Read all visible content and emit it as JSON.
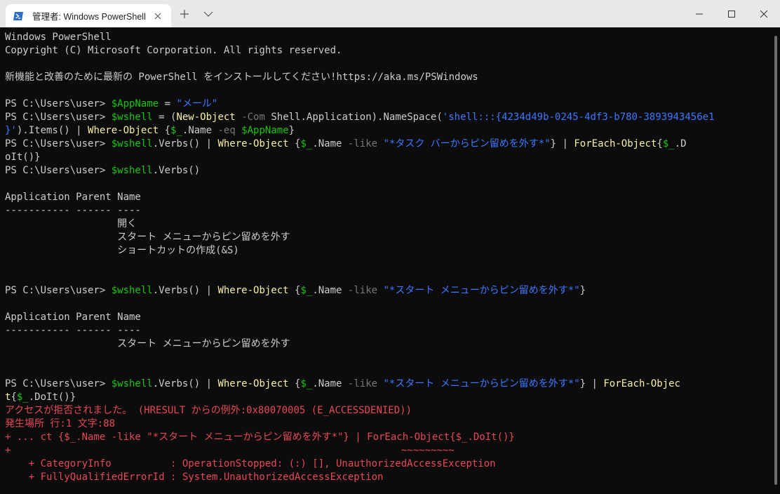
{
  "window": {
    "tab_title": "管理者: Windows PowerShell",
    "icons": {
      "tab": "powershell-icon",
      "close": "close-icon",
      "new_tab": "plus-icon",
      "dropdown": "chevron-down-icon",
      "minimize": "minimize-icon",
      "maximize": "maximize-icon",
      "window_close": "close-icon"
    }
  },
  "colors": {
    "background": "#0c0c0c",
    "text": "#cccccc",
    "variable": "#16c60c",
    "string": "#3b78ff",
    "command": "#f9f1a5",
    "parameter": "#767676",
    "error": "#e74856",
    "titlebar": "#e8e8e8"
  },
  "terminal": {
    "lines": [
      [
        {
          "t": "Windows PowerShell",
          "c": "default"
        }
      ],
      [
        {
          "t": "Copyright (C) Microsoft Corporation. All rights reserved.",
          "c": "default"
        }
      ],
      [],
      [
        {
          "t": "新機能と改善のために最新の PowerShell をインストールしてください!https://aka.ms/PSWindows",
          "c": "default"
        }
      ],
      [],
      [
        {
          "t": "PS C:\\Users\\user> ",
          "c": "default"
        },
        {
          "t": "$AppName",
          "c": "var"
        },
        {
          "t": " = ",
          "c": "default"
        },
        {
          "t": "\"メール\"",
          "c": "str"
        }
      ],
      [
        {
          "t": "PS C:\\Users\\user> ",
          "c": "default"
        },
        {
          "t": "$wshell",
          "c": "var"
        },
        {
          "t": " = (",
          "c": "default"
        },
        {
          "t": "New-Object",
          "c": "cmd"
        },
        {
          "t": " ",
          "c": "default"
        },
        {
          "t": "-Com",
          "c": "param"
        },
        {
          "t": " Shell.Application).NameSpace(",
          "c": "default"
        },
        {
          "t": "'shell:::{4234d49b-0245-4df3-b780-3893943456e1",
          "c": "str"
        }
      ],
      [
        {
          "t": "}'",
          "c": "str"
        },
        {
          "t": ").Items() | ",
          "c": "default"
        },
        {
          "t": "Where-Object",
          "c": "cmd"
        },
        {
          "t": " {",
          "c": "default"
        },
        {
          "t": "$_",
          "c": "var"
        },
        {
          "t": ".Name ",
          "c": "default"
        },
        {
          "t": "-eq",
          "c": "param"
        },
        {
          "t": " ",
          "c": "default"
        },
        {
          "t": "$AppName",
          "c": "var"
        },
        {
          "t": "}",
          "c": "default"
        }
      ],
      [
        {
          "t": "PS C:\\Users\\user> ",
          "c": "default"
        },
        {
          "t": "$wshell",
          "c": "var"
        },
        {
          "t": ".Verbs() | ",
          "c": "default"
        },
        {
          "t": "Where-Object",
          "c": "cmd"
        },
        {
          "t": " {",
          "c": "default"
        },
        {
          "t": "$_",
          "c": "var"
        },
        {
          "t": ".Name ",
          "c": "default"
        },
        {
          "t": "-like",
          "c": "param"
        },
        {
          "t": " ",
          "c": "default"
        },
        {
          "t": "\"*タスク バーからピン留めを外す*\"",
          "c": "str"
        },
        {
          "t": "} | ",
          "c": "default"
        },
        {
          "t": "ForEach-Object",
          "c": "cmd"
        },
        {
          "t": "{",
          "c": "default"
        },
        {
          "t": "$_",
          "c": "var"
        },
        {
          "t": ".D",
          "c": "default"
        }
      ],
      [
        {
          "t": "oIt()}",
          "c": "default"
        }
      ],
      [
        {
          "t": "PS C:\\Users\\user> ",
          "c": "default"
        },
        {
          "t": "$wshell",
          "c": "var"
        },
        {
          "t": ".Verbs()",
          "c": "default"
        }
      ],
      [],
      [
        {
          "t": "Application Parent Name",
          "c": "default"
        }
      ],
      [
        {
          "t": "----------- ------ ----",
          "c": "default"
        }
      ],
      [
        {
          "t": "                   開く",
          "c": "default"
        }
      ],
      [
        {
          "t": "                   スタート メニューからピン留めを外す",
          "c": "default"
        }
      ],
      [
        {
          "t": "                   ショートカットの作成(&S)",
          "c": "default"
        }
      ],
      [],
      [],
      [
        {
          "t": "PS C:\\Users\\user> ",
          "c": "default"
        },
        {
          "t": "$wshell",
          "c": "var"
        },
        {
          "t": ".Verbs() | ",
          "c": "default"
        },
        {
          "t": "Where-Object",
          "c": "cmd"
        },
        {
          "t": " {",
          "c": "default"
        },
        {
          "t": "$_",
          "c": "var"
        },
        {
          "t": ".Name ",
          "c": "default"
        },
        {
          "t": "-like",
          "c": "param"
        },
        {
          "t": " ",
          "c": "default"
        },
        {
          "t": "\"*スタート メニューからピン留めを外す*\"",
          "c": "str"
        },
        {
          "t": "}",
          "c": "default"
        }
      ],
      [],
      [
        {
          "t": "Application Parent Name",
          "c": "default"
        }
      ],
      [
        {
          "t": "----------- ------ ----",
          "c": "default"
        }
      ],
      [
        {
          "t": "                   スタート メニューからピン留めを外す",
          "c": "default"
        }
      ],
      [],
      [],
      [
        {
          "t": "PS C:\\Users\\user> ",
          "c": "default"
        },
        {
          "t": "$wshell",
          "c": "var"
        },
        {
          "t": ".Verbs() | ",
          "c": "default"
        },
        {
          "t": "Where-Object",
          "c": "cmd"
        },
        {
          "t": " {",
          "c": "default"
        },
        {
          "t": "$_",
          "c": "var"
        },
        {
          "t": ".Name ",
          "c": "default"
        },
        {
          "t": "-like",
          "c": "param"
        },
        {
          "t": " ",
          "c": "default"
        },
        {
          "t": "\"*スタート メニューからピン留めを外す*\"",
          "c": "str"
        },
        {
          "t": "} | ",
          "c": "default"
        },
        {
          "t": "ForEach-Objec",
          "c": "cmd"
        }
      ],
      [
        {
          "t": "t",
          "c": "cmd"
        },
        {
          "t": "{",
          "c": "default"
        },
        {
          "t": "$_",
          "c": "var"
        },
        {
          "t": ".DoIt()}",
          "c": "default"
        }
      ],
      [
        {
          "t": "アクセスが拒否されました。 (HRESULT からの例外:0x80070005 (E_ACCESSDENIED))",
          "c": "err"
        }
      ],
      [
        {
          "t": "発生場所 行:1 文字:88",
          "c": "err"
        }
      ],
      [
        {
          "t": "+ ... ct {$_.Name -like \"*スタート メニューからピン留めを外す*\"} | ForEach-Object{$_.DoIt()}",
          "c": "err"
        }
      ],
      [
        {
          "t": "+                                                                  ~~~~~~~~~",
          "c": "err"
        }
      ],
      [
        {
          "t": "    + CategoryInfo          : OperationStopped: (:) [], UnauthorizedAccessException",
          "c": "err"
        }
      ],
      [
        {
          "t": "    + FullyQualifiedErrorId : System.UnauthorizedAccessException",
          "c": "err"
        }
      ]
    ]
  }
}
